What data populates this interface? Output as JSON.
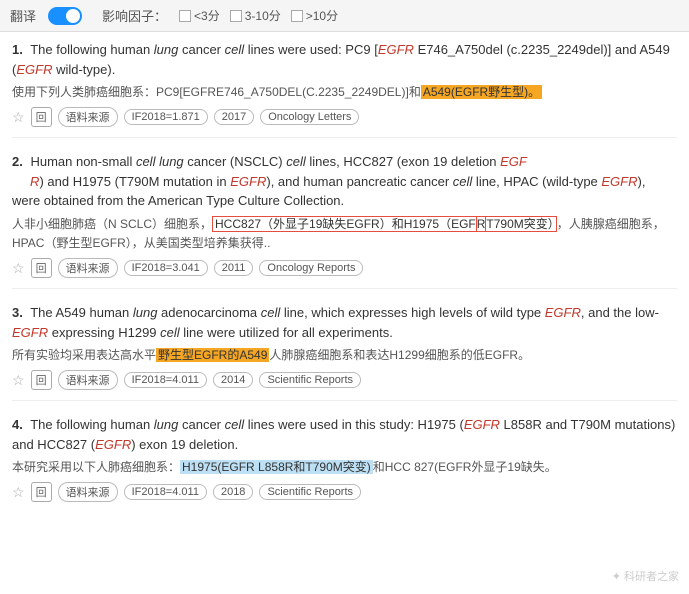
{
  "topbar": {
    "translate_label": "翻译",
    "impact_label": "影响因子：",
    "options": [
      "<3分",
      "3-10分",
      ">10分"
    ]
  },
  "results": [
    {
      "number": "1.",
      "text_en_parts": [
        {
          "t": "The following human ",
          "style": ""
        },
        {
          "t": "lung",
          "style": "italic"
        },
        {
          "t": " cancer ",
          "style": ""
        },
        {
          "t": "cell",
          "style": "italic"
        },
        {
          "t": " lines were used: PC9 [",
          "style": ""
        },
        {
          "t": "EGFR",
          "style": "red-italic"
        },
        {
          "t": " E746_A750del (c.2235_2249del)] and A549 (",
          "style": ""
        },
        {
          "t": "EGFR",
          "style": "red-italic"
        },
        {
          "t": " wild-type).",
          "style": ""
        }
      ],
      "text_zh": "使用下列人类肺癌细胞系：PC9[EGFRE746_A750DEL(C.2235_2249DEL)]和",
      "text_zh_highlight": "A549(EGFR野生型)。",
      "text_zh_after": "",
      "meta": {
        "if_value": "IF2018=1.871",
        "year": "2017",
        "journal": "Oncology Letters"
      }
    },
    {
      "number": "2.",
      "text_en_parts": [
        {
          "t": "Human non-small ",
          "style": ""
        },
        {
          "t": "cell lung",
          "style": "italic"
        },
        {
          "t": " cancer (NSCLC) ",
          "style": ""
        },
        {
          "t": "cell",
          "style": "italic"
        },
        {
          "t": " lines, HCC827 (exon 19 deletion ",
          "style": ""
        },
        {
          "t": "EGF",
          "style": "red-italic"
        },
        {
          "t": "R) and H1975 (T790M mutation in ",
          "style": ""
        },
        {
          "t": "EGFR",
          "style": "red-italic"
        },
        {
          "t": "), and human pancreatic cancer ",
          "style": ""
        },
        {
          "t": "cell",
          "style": "italic"
        },
        {
          "t": " line, HPAC (wild-type ",
          "style": ""
        },
        {
          "t": "EGFR",
          "style": "red-italic"
        },
        {
          "t": "), were obtained from the American Type Culture Collection.",
          "style": ""
        }
      ],
      "text_zh": "人非小细胞肺癌（N SCLC）细胞系，",
      "text_zh_highlight": "HCC827（外显子19缺失EGFR）和H1975（EGF",
      "text_zh_middle": "R T790M突变）",
      "text_zh_after": "，人胰腺癌细胞系，HPAC（野生型EGFR），从美国类型培养集获得..",
      "meta": {
        "if_value": "IF2018=3.041",
        "year": "2011",
        "journal": "Oncology Reports"
      }
    },
    {
      "number": "3.",
      "text_en_parts": [
        {
          "t": "The A549 human ",
          "style": ""
        },
        {
          "t": "lung",
          "style": "italic"
        },
        {
          "t": " adenocarcinoma ",
          "style": ""
        },
        {
          "t": "cell",
          "style": "italic"
        },
        {
          "t": " line, which expresses high levels of wild type ",
          "style": ""
        },
        {
          "t": "EGFR",
          "style": "red-italic"
        },
        {
          "t": ", and the low-",
          "style": ""
        },
        {
          "t": "EGFR",
          "style": "red-italic"
        },
        {
          "t": " expressing H1299 ",
          "style": ""
        },
        {
          "t": "cell",
          "style": "italic"
        },
        {
          "t": " line were utilized for all experiments.",
          "style": ""
        }
      ],
      "text_zh": "所有实验均采用表达高水平",
      "text_zh_highlight": "野生型EGFR的A549",
      "text_zh_after": "人肺腺癌细胞系和表达H1299细胞系的低EGFR。",
      "meta": {
        "if_value": "IF2018=4.011",
        "year": "2014",
        "journal": "Scientific Reports"
      }
    },
    {
      "number": "4.",
      "text_en_parts": [
        {
          "t": "The following human ",
          "style": ""
        },
        {
          "t": "lung",
          "style": "italic"
        },
        {
          "t": " cancer ",
          "style": ""
        },
        {
          "t": "cell",
          "style": "italic"
        },
        {
          "t": " lines were used in this study: H1975 (",
          "style": ""
        },
        {
          "t": "EGFR",
          "style": "red-italic"
        },
        {
          "t": " L858R and T790M mutations) and HCC827 (",
          "style": ""
        },
        {
          "t": "EGFR",
          "style": "red-italic"
        },
        {
          "t": ") exon 19 deletion.",
          "style": ""
        }
      ],
      "text_zh": "本研究采用以下人肺癌细胞系：",
      "text_zh_highlight": "H1975(EGFR L858R和T790M突变)",
      "text_zh_after": "和HCC 827(EGFR外显子19缺失。",
      "meta": {
        "if_value": "IF2018=4.011",
        "year": "2018",
        "journal": "Scientific Reports"
      }
    }
  ],
  "watermark": "科研者之家"
}
